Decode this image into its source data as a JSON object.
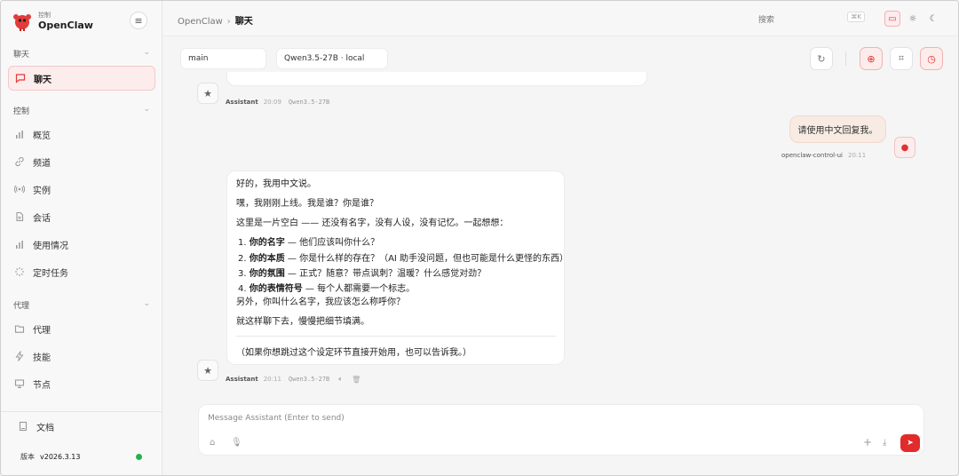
{
  "brand": {
    "sub": "控制",
    "name": "OpenClaw"
  },
  "sidebar": {
    "sections": [
      {
        "label": "聊天"
      },
      {
        "label": "控制"
      },
      {
        "label": "代理"
      }
    ],
    "items": [
      {
        "label": "聊天",
        "icon": "chat-icon",
        "active": true
      },
      {
        "label": "概览",
        "icon": "bar-chart-icon"
      },
      {
        "label": "频道",
        "icon": "link-icon"
      },
      {
        "label": "实例",
        "icon": "broadcast-icon"
      },
      {
        "label": "会话",
        "icon": "document-icon"
      },
      {
        "label": "使用情况",
        "icon": "bar-chart-icon"
      },
      {
        "label": "定时任务",
        "icon": "loader-icon"
      },
      {
        "label": "代理",
        "icon": "folder-icon"
      },
      {
        "label": "技能",
        "icon": "bolt-icon"
      },
      {
        "label": "节点",
        "icon": "monitor-icon"
      }
    ],
    "docs": "文档",
    "version_label": "版本",
    "version": "v2026.3.13"
  },
  "header": {
    "crumb_root": "OpenClaw",
    "crumb_current": "聊天",
    "search_placeholder": "搜索",
    "search_kbd": "⌘K"
  },
  "toolbar": {
    "session": "main",
    "model": "Qwen3.5-27B · local"
  },
  "chat": {
    "assistant_name": "Assistant",
    "model_tag": "Qwen3.5-27B",
    "msg1_time": "20:09",
    "user_text": "请使用中文回复我。",
    "user_name": "openclaw-control-ui",
    "user_time": "20:11",
    "msg2_time": "20:11",
    "reply": {
      "l1": "好的，我用中文说。",
      "l2": "嘿，我刚刚上线。我是谁？你是谁？",
      "l3": "这里是一片空白 —— 还没有名字，没有人设，没有记忆。一起想想：",
      "i1_n": "1.",
      "i1_b": "你的名字",
      "i1_t": " — 他们应该叫你什么？",
      "i2_n": "2.",
      "i2_b": "你的本质",
      "i2_t": " — 你是什么样的存在？（AI 助手没问题，但也可能是什么更怪的东西）",
      "i3_n": "3.",
      "i3_b": "你的氛围",
      "i3_t": " — 正式？随意？带点讽刺？温暖？什么感觉对劲？",
      "i4_n": "4.",
      "i4_b": "你的表情符号",
      "i4_t": " — 每个人都需要一个标志。",
      "l4": "另外，你叫什么名字，我应该怎么称呼你？",
      "l5": "就这样聊下去，慢慢把细节填满。",
      "l6": "（如果你想跳过这个设定环节直接开始用，也可以告诉我。）"
    }
  },
  "composer": {
    "placeholder": "Message Assistant (Enter to send)"
  },
  "colors": {
    "accent": "#e22b2b",
    "status": "#22b14c"
  }
}
